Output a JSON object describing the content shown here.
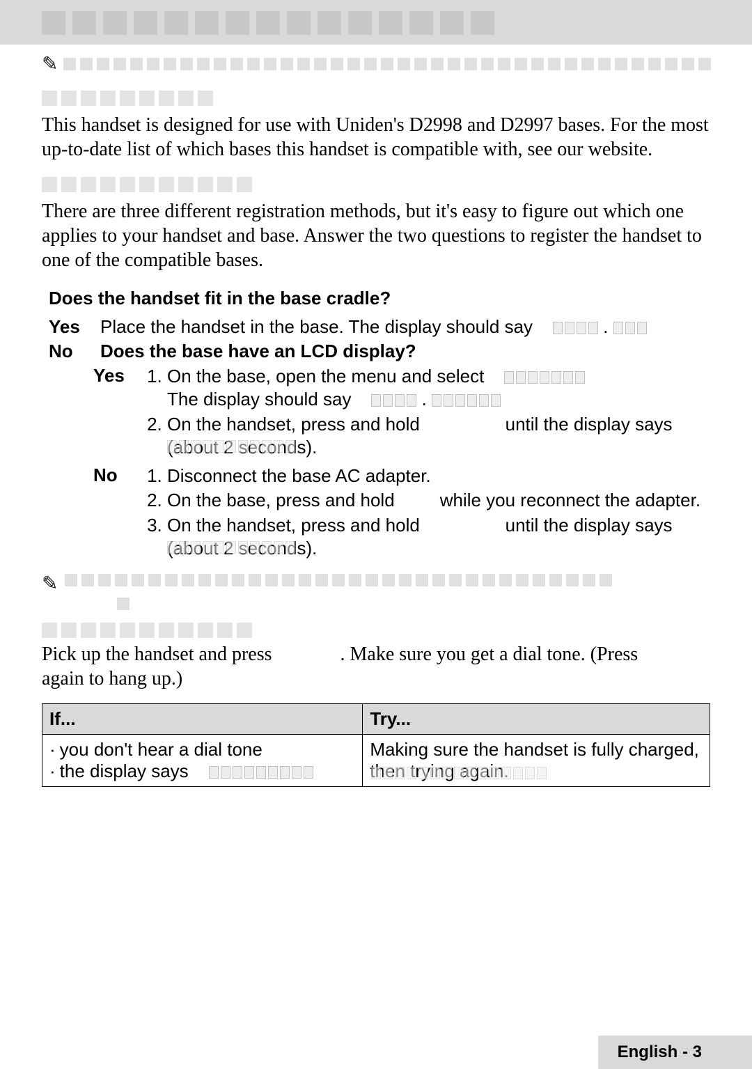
{
  "intro_paragraph": "This handset is designed for use with Uniden's D2998 and D2997 bases. For the most up-to-date list of which bases this handset is compatible with, see our website.",
  "reg_intro": "There are three different registration methods, but it's easy to figure out which one applies to your handset and base. Answer the two questions to register the handset to one of the compatible bases.",
  "q1": "Does the handset fit in the base cradle?",
  "yes_label": "Yes",
  "no_label": "No",
  "q1_yes_text": "Place the handset in the base. The display should say",
  "q2": "Does the base have an LCD display?",
  "q2_yes_step1_a": "On the base, open the menu and select",
  "q2_yes_step1_b": "The display should say",
  "q2_yes_step2_a": "On the handset, press and hold",
  "q2_yes_step2_b": "until the display says",
  "about2": "(about 2 seconds).",
  "q2_no_step1": "Disconnect the base AC adapter.",
  "q2_no_step2_a": "On the base, press and hold",
  "q2_no_step2_b": "while you reconnect the adapter.",
  "q2_no_step3_a": "On the handset, press and hold",
  "q2_no_step3_b": "until the display says",
  "connect_a": "Pick up the handset and press",
  "connect_b": ". Make sure you get a dial tone. (Press",
  "connect_c": "again to hang up.)",
  "table": {
    "h1": "If...",
    "h2": "Try...",
    "r1c1_a": "you don't hear a dial tone",
    "r1c1_b": "the display says",
    "r1c2": "Making sure the handset is fully charged, then trying again."
  },
  "footer": "English - 3"
}
